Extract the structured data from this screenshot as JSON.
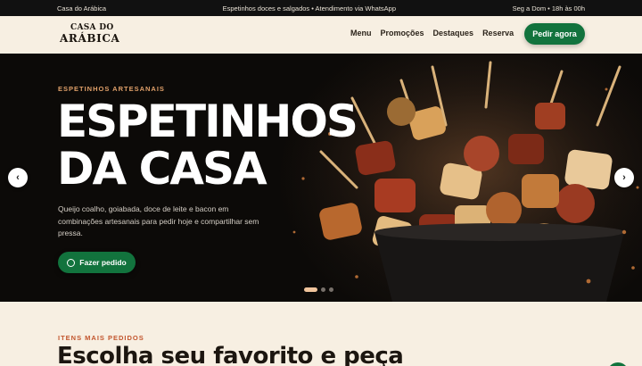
{
  "topbar": {
    "left": "Casa do Arábica",
    "center": "Espetinhos doces e salgados • Atendimento via WhatsApp",
    "right": "Seg a Dom • 18h às 00h"
  },
  "header": {
    "logo_line1": "CASA DO",
    "logo_line2": "ARÁBICA",
    "nav": [
      "Menu",
      "Promoções",
      "Destaques",
      "Reserva"
    ],
    "order_button": "Pedir agora"
  },
  "hero": {
    "eyebrow": "ESPETINHOS ARTESANAIS",
    "title_line1": "ESPETINHOS",
    "title_line2": "DA CASA",
    "description": "Queijo coalho, goiabada, doce de leite e bacon em combinações artesanais para pedir hoje e compartilhar sem pressa.",
    "cta": "Fazer pedido",
    "prev_arrow": "‹",
    "next_arrow": "›",
    "slides_total": 3,
    "active_slide": 1
  },
  "section": {
    "eyebrow": "ITENS MAIS PEDIDOS",
    "title": "Escolha seu favorito e peça"
  },
  "colors": {
    "brand_green": "#12733d",
    "cream": "#f7efe2",
    "accent_orange": "#c2552d"
  }
}
